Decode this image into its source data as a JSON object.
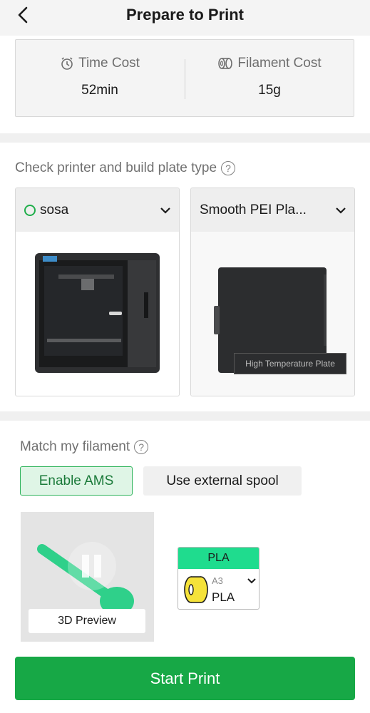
{
  "header": {
    "title": "Prepare to Print"
  },
  "costs": {
    "time_label": "Time Cost",
    "time_value": "52min",
    "filament_label": "Filament Cost",
    "filament_value": "15g"
  },
  "printer_section": {
    "title": "Check printer and build plate type",
    "printer_name": "sosa",
    "printer_status_color": "#1fae4a",
    "plate_name": "Smooth PEI Pla...",
    "plate_image_text": "High Temperature Plate"
  },
  "filament_section": {
    "title": "Match my filament",
    "enable_ams_label": "Enable AMS",
    "external_spool_label": "Use external spool",
    "preview_label": "3D Preview",
    "filament_card": {
      "header": "PLA",
      "header_color": "#1fdc8e",
      "slot": "A3",
      "type": "PLA",
      "spool_color": "#f5e23a"
    }
  },
  "start_button": {
    "label": "Start Print",
    "color": "#17a846"
  }
}
